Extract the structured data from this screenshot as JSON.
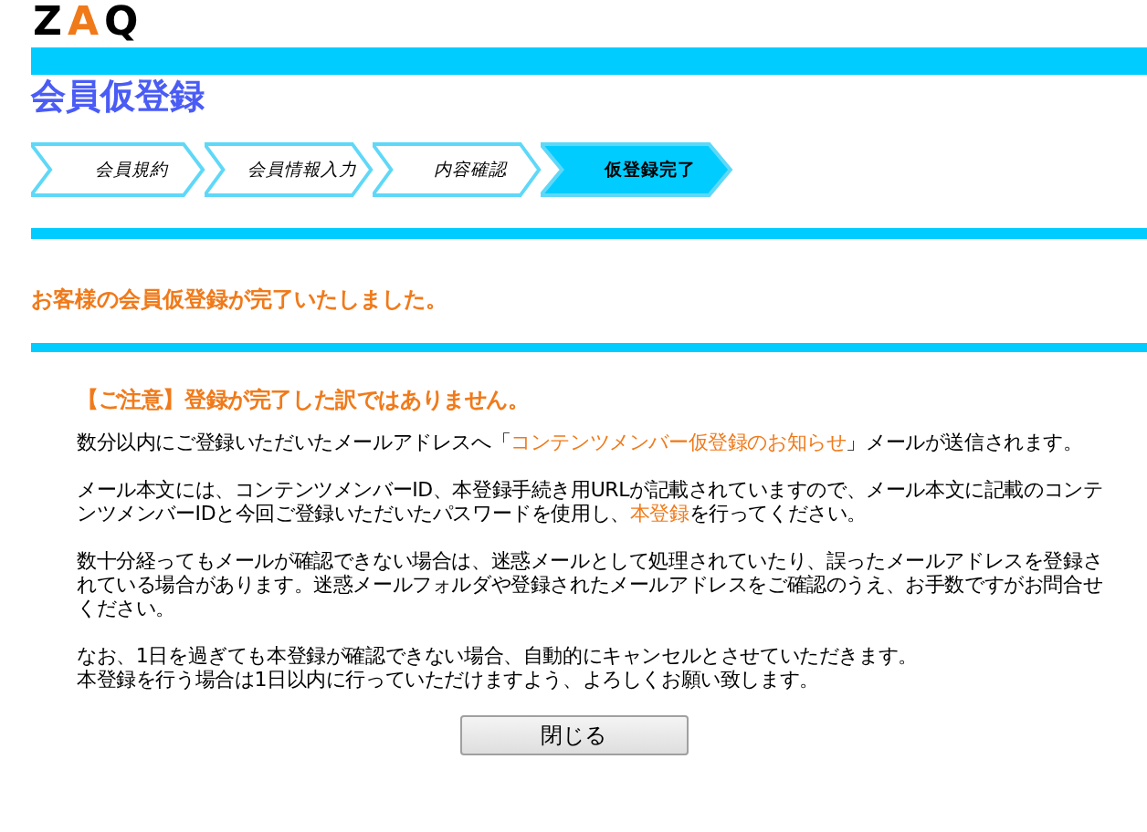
{
  "logo": {
    "letters": [
      {
        "text": "Z",
        "color": "#000000"
      },
      {
        "text": "A",
        "color": "#f07a1a"
      },
      {
        "text": "Q",
        "color": "#000000"
      }
    ]
  },
  "page_title": "会員仮登録",
  "steps": [
    {
      "label": "会員規約",
      "selected": false
    },
    {
      "label": "会員情報入力",
      "selected": false
    },
    {
      "label": "内容確認",
      "selected": false
    },
    {
      "label": "仮登録完了",
      "selected": true
    }
  ],
  "heading": "お客様の会員仮登録が完了いたしました。",
  "notice": {
    "title": "【ご注意】登録が完了した訳ではありません。",
    "paragraphs": [
      {
        "lines": [
          [
            {
              "kind": "plain",
              "text": "数分以内にご登録いただいたメールアドレスへ「"
            },
            {
              "kind": "link",
              "text": "コンテンツメンバー仮登録のお知らせ"
            },
            {
              "kind": "plain",
              "text": "」メールが送信されます。"
            }
          ]
        ]
      },
      {
        "lines": [
          [
            {
              "kind": "plain",
              "text": "メール本文には、コンテンツメンバーID、本登録手続き用URLが記載されていますので、メール本文に記載のコンテンツメンバーIDと今回ご登録いただいたパスワードを使用し、"
            },
            {
              "kind": "link",
              "text": "本登録"
            },
            {
              "kind": "plain",
              "text": "を行ってください。"
            }
          ]
        ]
      },
      {
        "lines": [
          [
            {
              "kind": "plain",
              "text": "数十分経ってもメールが確認できない場合は、迷惑メールとして処理されていたり、誤ったメールアドレスを登録されている場合があります。迷惑メールフォルダや登録されたメールアドレスをご確認のうえ、お手数ですがお問合せください。"
            }
          ]
        ]
      },
      {
        "lines": [
          [
            {
              "kind": "plain",
              "text": "なお、1日を過ぎても本登録が確認できない場合、自動的にキャンセルとさせていただきます。"
            }
          ],
          [
            {
              "kind": "plain",
              "text": "本登録を行う場合は1日以内に行っていただけますよう、よろしくお願い致します。"
            }
          ]
        ]
      }
    ]
  },
  "close_button": "閉じる"
}
